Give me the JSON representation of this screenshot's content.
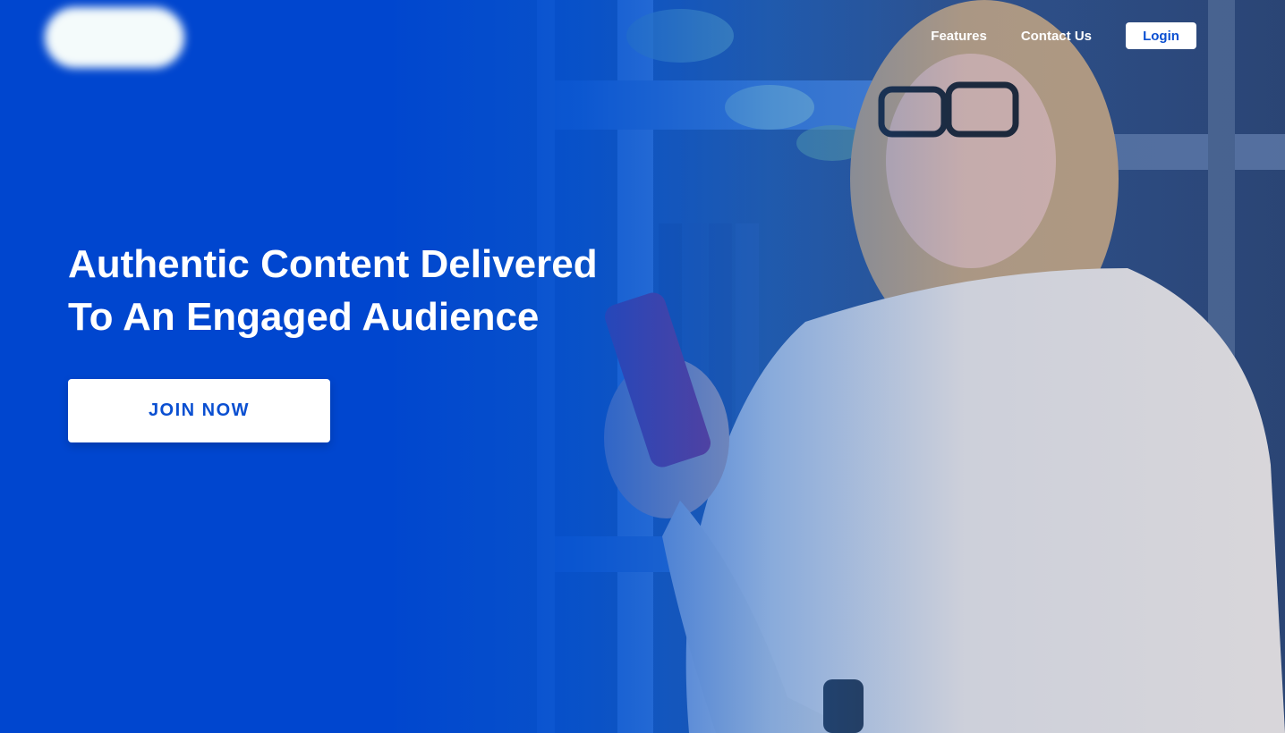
{
  "nav": {
    "links": [
      "Features",
      "Contact Us"
    ],
    "login_label": "Login"
  },
  "hero": {
    "headline_line1": "Authentic Content Delivered",
    "headline_line2": "To An Engaged Audience",
    "cta_label": "JOIN NOW"
  },
  "colors": {
    "brand_blue": "#0046cf",
    "button_text": "#0a4fd1",
    "white": "#ffffff"
  }
}
